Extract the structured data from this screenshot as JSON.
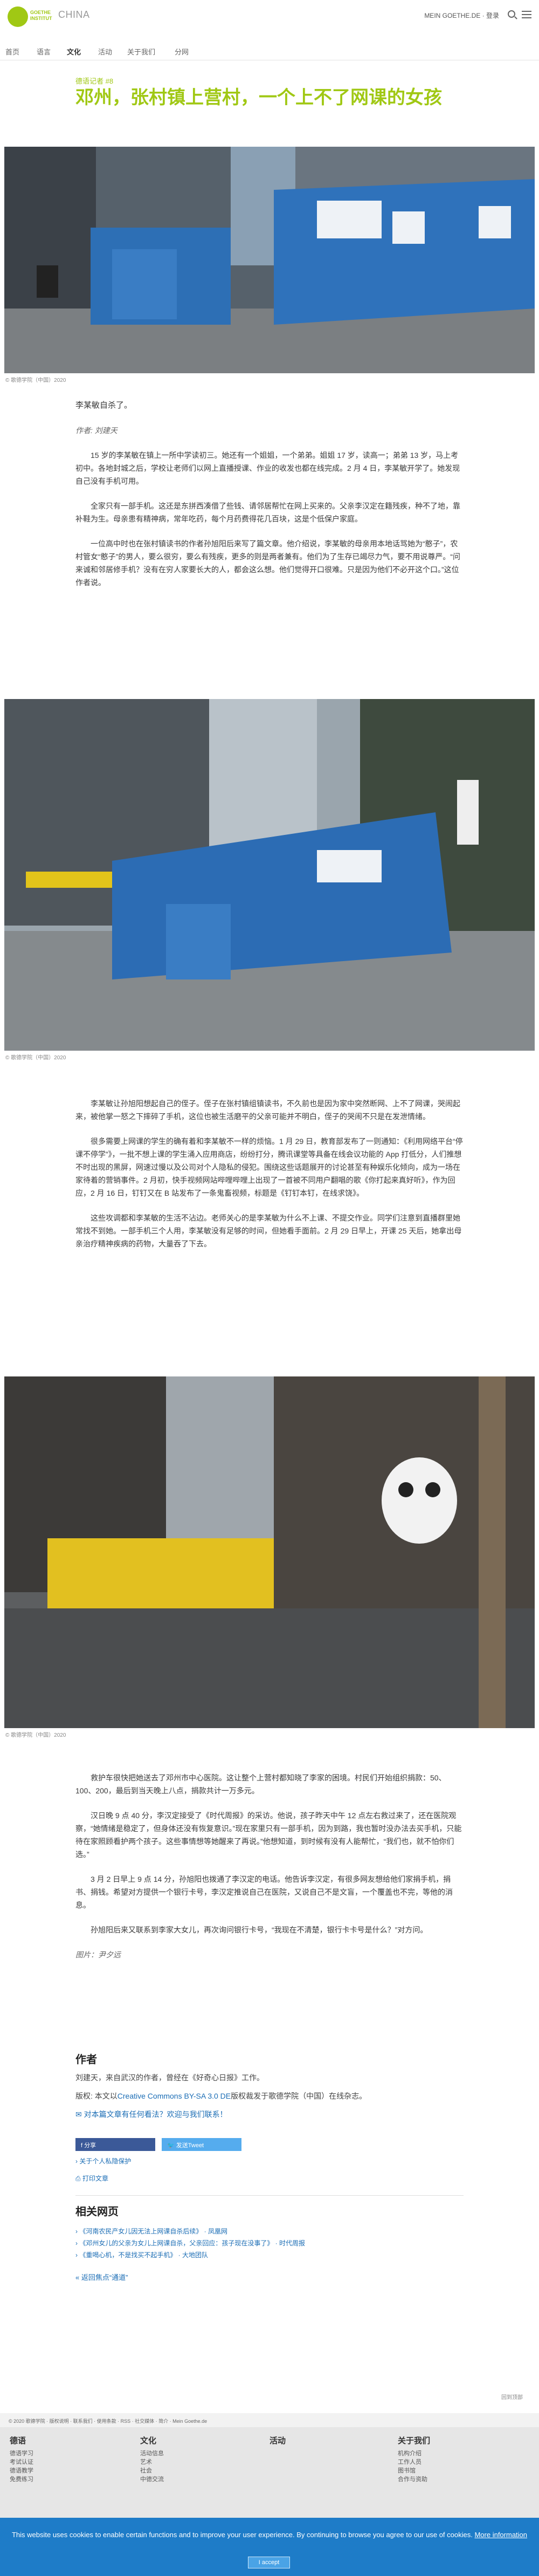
{
  "header": {
    "logo_text": "GOETHE INSTITUT",
    "country": "CHINA",
    "account": "MEIN GOETHE.DE · 登录",
    "nav": [
      "首页",
      "语言",
      "文化",
      "活动",
      "关于我们",
      "分网"
    ]
  },
  "article": {
    "kicker": "德语记者 #8",
    "title": "邓州，张村镇上营村，一个上不了网课的女孩",
    "photo_caption": "© 歌德学院（中国）2020",
    "lead": "李某敏自杀了。",
    "byline": "作者: 刘建天",
    "paragraphs_1": [
      "15 岁的李某敏在镇上一所中学读初三。她还有一个姐姐，一个弟弟。姐姐 17 岁，读高一；弟弟 13 岁，马上考初中。各地封城之后，学校让老师们以网上直播授课、作业的收发也都在线完成。2 月 4 日，李某敏开学了。她发现自己没有手机可用。",
      "全家只有一部手机。这还是东拼西凑借了些钱、请邻居帮忙在网上买来的。父亲李汉定在籍残疾，种不了地，靠补鞋为生。母亲患有精神病，常年吃药，每个月药费得花几百块，这是个低保户家庭。",
      "一位高中时也在张村镇读书的作者孙旭阳后来写了篇文章。他介绍说，李某敏的母亲用本地话骂她为“憨子”，农村管女“憨子”的男人，要么很穷，要么有残疾，更多的则是两者兼有。他们为了生存已竭尽力气，要不用说尊严。“问来诚和邻居修手机？没有在穷人家要长大的人，都会这么想。他们觉得开口很难。只是因为他们不必开这个口。”这位作者说。"
    ],
    "paragraphs_2": [
      "李某敏让孙旭阳想起自己的侄子。侄子在张村镇组镇读书，不久前也是因为家中突然断网、上不了网课，哭闹起来，被他掌一怒之下摔碎了手机，这位也被生活磨平的父亲可能并不明白，侄子的哭闹不只是在发泄情绪。",
      "很多需要上网课的学生的确有着和李某敏不一样的烦恼。1 月 29 日，教育部发布了一则通知：《利用网络平台“停课不停学”》，一批不想上课的学生涌入应用商店，纷纷打分，腾讯课堂等具备在线会议功能的 App 打低分，人们推想不时出现的黑屏，网速过慢以及公司对个人隐私的侵犯。围绕这些话题展开的讨论甚至有种娱乐化倾向，成为一场在家待着的营销事件。2 月初，快手视频网站哔哩哔哩上出现了一首被不同用户翻唱的歌《你打起来真好听》，作为回应，2 月 16 日，钉钉又在 B 站发布了一条鬼畜视频，标题是《钉钉本钉，在线求饶》。",
      "这些攻调都和李某敏的生活不沾边。老师关心的是李某敏为什么不上课、不提交作业。同学们注意到直播群里她常找不到她。一部手机三个人用，李某敏没有足够的时间，但她看手面前。2 月 29 日早上，开课 25 天后，她拿出母亲治疗精神疾病的药物，大量吞了下去。"
    ],
    "paragraphs_3": [
      "救护车很快把她送去了邓州市中心医院。这让整个上营村都知晓了李家的困境。村民们开始组织捐款：50、100、200，最后到当天晚上八点，捐款共计一万多元。",
      "汉日晚 9 点 40 分，李汉定接受了《时代周报》的采访。他说，孩子昨天中午 12 点左右救过来了，还在医院观察，“她情绪是稳定了，但身体还没有恢复意识。”现在家里只有一部手机，因为到路，我也暂时没办法去买手机，只能待在家照顾看护两个孩子。这些事情想等她醒来了再说。”他想知道，到时候有没有人能帮忙，“我们也，就不怕你们选。”",
      "3 月 2 日早上 9 点 14 分，孙旭阳也拨通了李汉定的电话。他告诉李汉定，有很多网友想给他们家捐手机，捐书、捐钱。希望对方提供一个银行卡号，李汉定推说自己在医院，又说自己不是文盲，一个覆盖也不完，等他的消息。",
      "孙旭阳后来又联系到李家大女儿，再次询问银行卡号，“我现在不清楚，银行卡卡号是什么？”对方问。"
    ],
    "photographer": "图片：尹夕远"
  },
  "author": {
    "heading": "作者",
    "bio": "刘建天，来自武汉的作者，曾经在《好奇心日报》工作。",
    "license_prefix": "版权: 本文以",
    "license_link": "Creative Commons BY-SA 3.0 DE",
    "license_suffix": "版权裁发于歌德学院（中国）在线杂志。",
    "question": "对本篇文章有任何看法？欢迎与我们联系！"
  },
  "share": {
    "facebook": "分享",
    "twitter": "发送Tweet",
    "privacy": "关于个人私隐保护",
    "print": "打印文章"
  },
  "related": {
    "heading": "相关网页",
    "items": [
      "《河南农民产女儿因无法上网课自杀后续》 · 凤凰网",
      "《邓州女儿的父亲为女儿上网课自杀，父亲回应：孩子现在没事了》 · 时代周报",
      "《重喝心机，不是找买不起手机》 · 大地团队"
    ],
    "back": "返回焦点“通道”"
  },
  "footer": {
    "top_links": "© 2020 歌德学院 · 版权说明 · 联系我们 · 使用条款 · RSS · 社交媒体 · 简介 · Mein Goethe.de",
    "to_top": "回到顶部",
    "columns": [
      {
        "heading": "德语",
        "items": [
          "德语学习",
          "考试认证",
          "德语教学",
          "免费练习"
        ]
      },
      {
        "heading": "文化",
        "items": [
          "活动信息",
          "艺术",
          "社会",
          "中德交流"
        ]
      },
      {
        "heading": "活动",
        "items": []
      },
      {
        "heading": "关于我们",
        "items": [
          "机构介绍",
          "工作人员",
          "图书馆",
          "合作与资助"
        ]
      }
    ]
  },
  "cookie": {
    "text": "This website uses cookies to enable certain functions and to improve your user experience. By continuing to browse you agree to our use of cookies.",
    "more": "More information",
    "accept": "I accept"
  },
  "colors": {
    "brand_green": "#a0c814",
    "link_blue": "#1b6db5",
    "cookie_blue": "#1e7cc8"
  }
}
